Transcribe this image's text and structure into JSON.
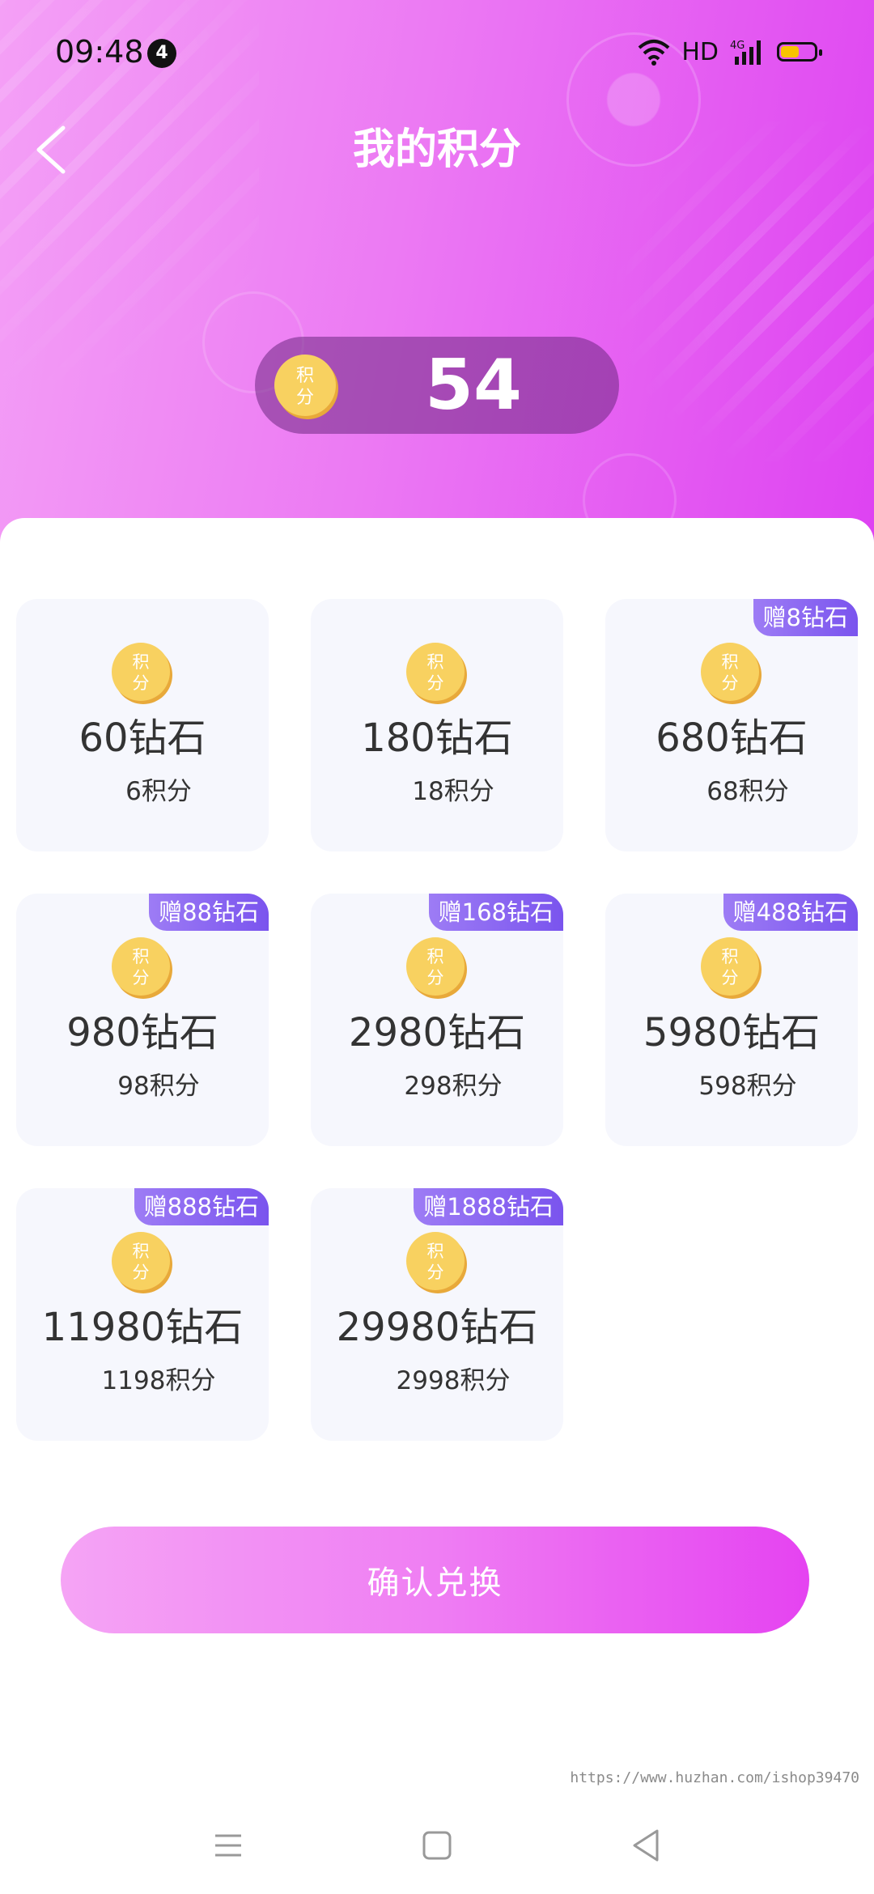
{
  "status_bar": {
    "time": "09:48",
    "notification_count": "4",
    "network_label": "HD",
    "network_type": "4G"
  },
  "header": {
    "title": "我的积分"
  },
  "points": {
    "icon_text_top": "积",
    "icon_text_bottom": "分",
    "value": "54"
  },
  "coin_icon": {
    "top": "积",
    "bottom": "分"
  },
  "packages": [
    {
      "diamonds": "60钻石",
      "cost": "6积分",
      "bonus": ""
    },
    {
      "diamonds": "180钻石",
      "cost": "18积分",
      "bonus": ""
    },
    {
      "diamonds": "680钻石",
      "cost": "68积分",
      "bonus": "赠8钻石"
    },
    {
      "diamonds": "980钻石",
      "cost": "98积分",
      "bonus": "赠88钻石"
    },
    {
      "diamonds": "2980钻石",
      "cost": "298积分",
      "bonus": "赠168钻石"
    },
    {
      "diamonds": "5980钻石",
      "cost": "598积分",
      "bonus": "赠488钻石"
    },
    {
      "diamonds": "11980钻石",
      "cost": "1198积分",
      "bonus": "赠888钻石"
    },
    {
      "diamonds": "29980钻石",
      "cost": "2998积分",
      "bonus": "赠1888钻石"
    }
  ],
  "confirm": {
    "label": "确认兑换"
  },
  "watermark": {
    "text": "https://www.huzhan.com/ishop39470"
  },
  "colors": {
    "accent": "#e543f1",
    "accent_light": "#f5a4f5",
    "tag": "#7a54ee",
    "coin": "#f7c948"
  },
  "icons": {
    "back": "chevron-left-icon",
    "nav_menu": "menu-icon",
    "nav_home": "square-icon",
    "nav_back": "triangle-back-icon"
  }
}
